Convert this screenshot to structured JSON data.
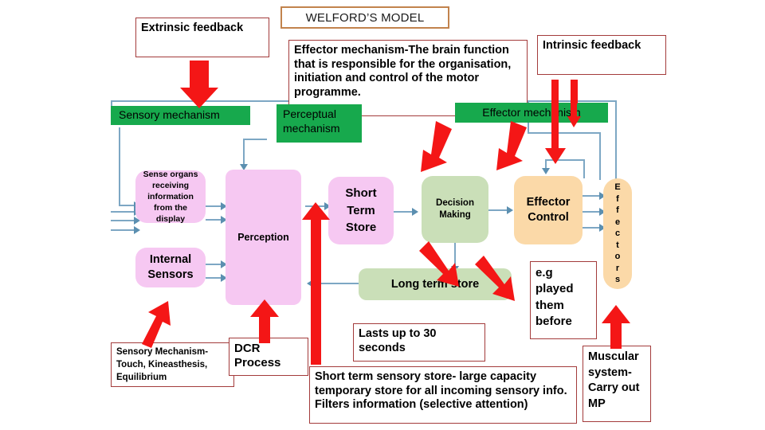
{
  "title": {
    "text": "WELFORD’S MODEL",
    "border_color": "#c2834d"
  },
  "palette": {
    "green_header": "#17a94d",
    "pink_node": "#f6c8f2",
    "green_node": "#cadfb8",
    "orange_node": "#fbd9a8",
    "red_arrow": "#f41616",
    "blue_connector": "#7da7c4",
    "callout_border": "#a33b3b"
  },
  "headers": {
    "sensory_mechanism": "Sensory mechanism",
    "perceptual_mechanism": "Perceptual mechanism",
    "effector_mechanism": "Effector mechanism"
  },
  "callouts": {
    "extrinsic_feedback": "Extrinsic feedback",
    "intrinsic_feedback": "Intrinsic feedback",
    "effector_definition": "Effector mechanism-The brain function that is responsible for the organisation, initiation and control of the motor programme.",
    "sensory_touch": "Sensory Mechanism-Touch, Kineasthesis, Equilibrium",
    "dcr_process": "DCR Process",
    "lasts_up_to": "Lasts up to 30 seconds",
    "short_term_sensory_store": "Short term sensory store- large capacity temporary store for all incoming sensory info. Filters information (selective attention)",
    "eg_played_them_before": "e.g played them before",
    "muscular_system": "Muscular system-Carry out MP"
  },
  "nodes": {
    "sense_organs": "Sense organs receiving information from the display",
    "internal_sensors": "Internal Sensors",
    "perception": "Perception",
    "short_term_store": "Short Term Store",
    "decision_making": "Decision Making",
    "effector_control": "Effector Control",
    "long_term_store": "Long term store",
    "effectors_letters": [
      "E",
      "f",
      "f",
      "e",
      "c",
      "t",
      "o",
      "r",
      "s"
    ],
    "effectors_label": "Effectors"
  }
}
